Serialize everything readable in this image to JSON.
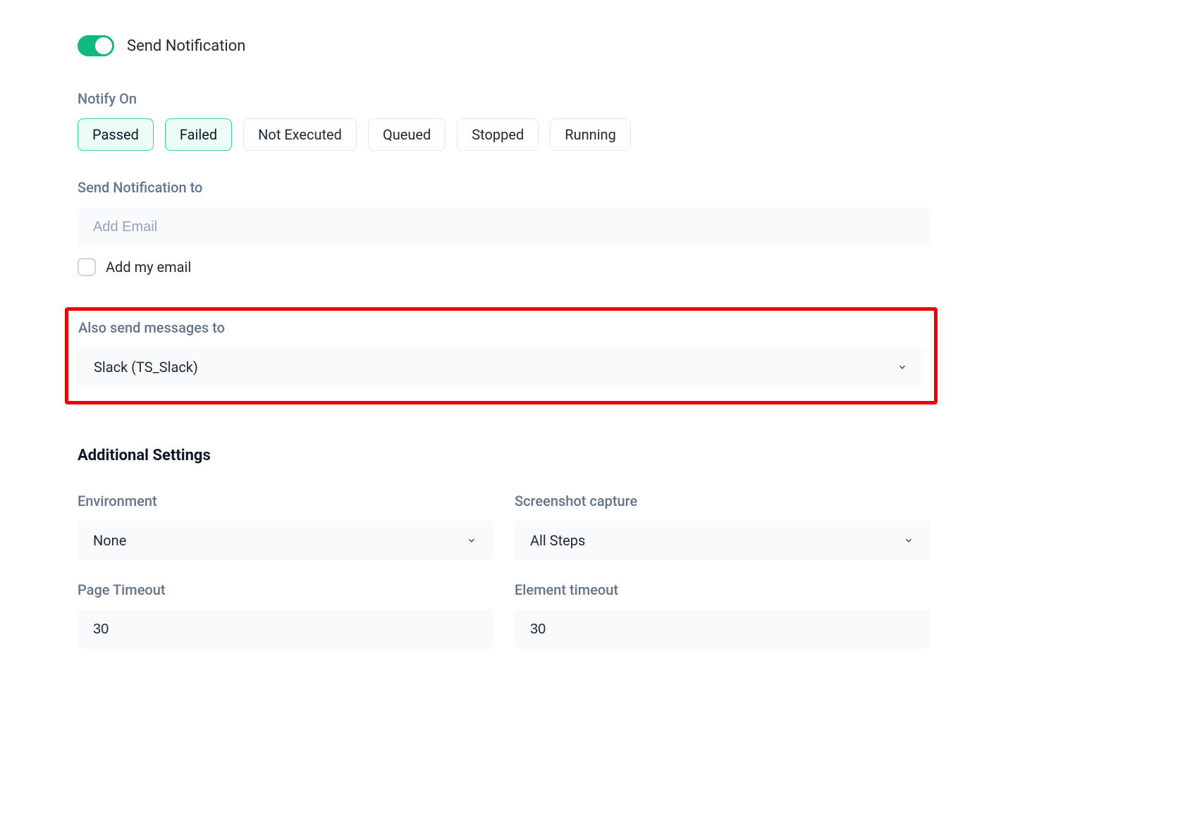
{
  "toggle": {
    "label": "Send Notification",
    "on": true
  },
  "notifyOn": {
    "label": "Notify On",
    "options": [
      {
        "label": "Passed",
        "selected": true
      },
      {
        "label": "Failed",
        "selected": true
      },
      {
        "label": "Not Executed",
        "selected": false
      },
      {
        "label": "Queued",
        "selected": false
      },
      {
        "label": "Stopped",
        "selected": false
      },
      {
        "label": "Running",
        "selected": false
      }
    ]
  },
  "sendTo": {
    "label": "Send Notification to",
    "placeholder": "Add Email",
    "checkboxLabel": "Add my email"
  },
  "alsoSend": {
    "label": "Also send messages to",
    "value": "Slack (TS_Slack)"
  },
  "additional": {
    "title": "Additional Settings",
    "environment": {
      "label": "Environment",
      "value": "None"
    },
    "screenshot": {
      "label": "Screenshot capture",
      "value": "All Steps"
    },
    "pageTimeout": {
      "label": "Page Timeout",
      "value": "30"
    },
    "elementTimeout": {
      "label": "Element timeout",
      "value": "30"
    }
  }
}
